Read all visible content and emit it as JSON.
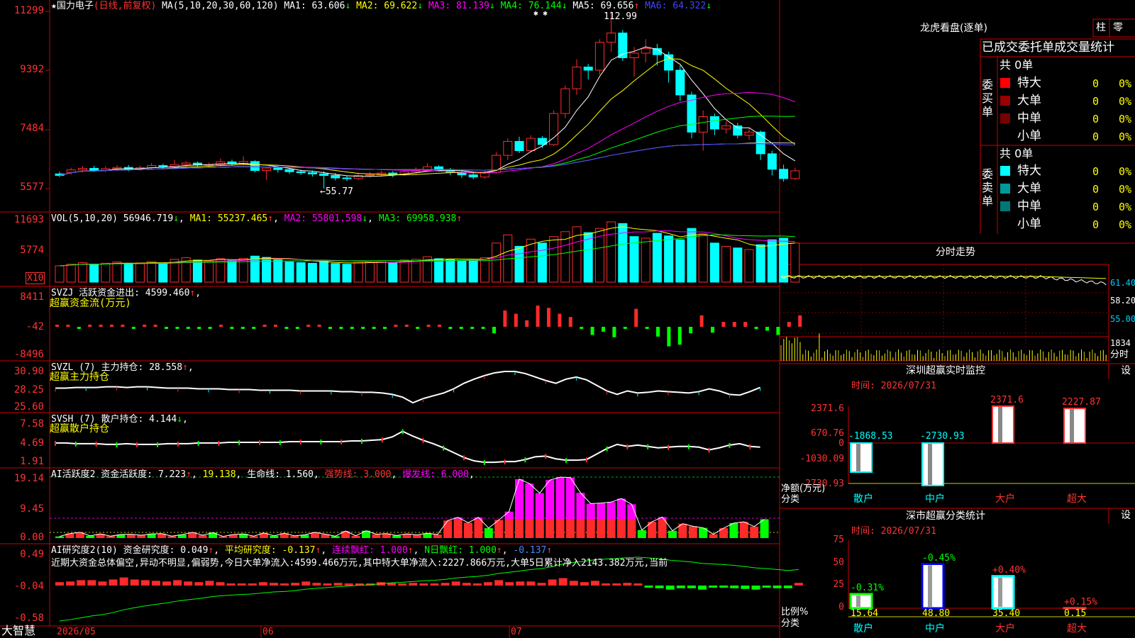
{
  "stock": {
    "name": "国力电子",
    "mode": "(日线,前复权)"
  },
  "colors": {
    "up": "#ff2a2a",
    "down": "#00ffff",
    "grid": "#cc0000",
    "yellow": "#ffff00",
    "magenta": "#ff00ff",
    "green": "#00ff00",
    "white": "#ffffff"
  },
  "panels": {
    "price": {
      "legend": "MA(5,10,20,30,60,120)",
      "ma": [
        {
          "label": "MA1: 63.606",
          "arrow": "↓",
          "color": "#ffffff"
        },
        {
          "label": "MA2: 69.622",
          "arrow": "↓",
          "color": "#ffff00"
        },
        {
          "label": "MA3: 81.139",
          "arrow": "↓",
          "color": "#ff00ff"
        },
        {
          "label": "MA4: 76.144",
          "arrow": "↓",
          "color": "#00ff00"
        },
        {
          "label": "MA5: 69.656",
          "arrow": "↑",
          "color": "#ffffff"
        },
        {
          "label": "MA6: 64.322",
          "arrow": "↓",
          "color": "#4444ff"
        }
      ],
      "y_labels": [
        "11299",
        "9392",
        "7484",
        "5577"
      ],
      "high_mark": "112.99",
      "low_mark": "←55.77",
      "asterisks": "✱ ✱"
    },
    "vol": {
      "legend": "VOL(5,10,20)",
      "value": "56946.719",
      "value_arrow": "↓",
      "ma1": "MA1: 55237.465",
      "ma1_arrow": "↑",
      "ma2": "MA2: 55801.598",
      "ma2_arrow": "↓",
      "ma3": "MA3: 69958.938",
      "ma3_arrow": "↑",
      "y_labels": [
        "11693",
        "5774"
      ],
      "unit": "X10"
    },
    "svzj": {
      "line1": "SVZJ  活跃资金进出: 4599.460",
      "line1_arrow": "↑",
      "line2": "超赢资金流(万元)",
      "y_labels": [
        "8411",
        "-42",
        "-8496"
      ]
    },
    "svzl": {
      "line1": "SVZL (7) 主力持仓: 28.558",
      "line1_arrow": "↑",
      "line2": "超赢主力持仓",
      "y_labels": [
        "30.90",
        "28.25",
        "25.60"
      ]
    },
    "svsh": {
      "line1": "SVSH (7) 散户持仓: 4.144",
      "line1_arrow": "↓",
      "line2": "超赢散户持仓",
      "y_labels": [
        "7.58",
        "4.69",
        "1.91"
      ]
    },
    "ai_active": {
      "title": "AI活跃度2 资金活跃度: 7.223",
      "v2": "19.138",
      "v3": "生命线: 1.560",
      "v4": "强势线: 3.000",
      "v5": "爆发线: 6.000",
      "y_labels": [
        "19.14",
        "9.45",
        "0.00"
      ]
    },
    "ai_research": {
      "title": "AI研究度2(10) 资金研究度: 0.049",
      "v2": "平均研究度: -0.137",
      "v3": "连续飘红: 1.000",
      "v4": "N日飘红: 1.000",
      "v5": "-0.137",
      "note": "近期大资金总体偏空,异动不明显,偏弱势,今日大单净流入:4599.466万元,其中特大单净流入:2227.866万元,大单5日累计净入2143.382万元,当前",
      "y_labels": [
        "0.49",
        "-0.04",
        "-0.58"
      ]
    }
  },
  "xaxis": {
    "brand": "大智慧",
    "dates": [
      "2026/05",
      "06",
      "07"
    ]
  },
  "right": {
    "lhb": {
      "title": "龙虎看盘(逐单)",
      "btn1": "柱",
      "btn2": "零"
    },
    "stats": {
      "header": "已成交委托单成交量统计",
      "buy_label": "委买单",
      "sell_label": "委卖单",
      "buy_total": "共 0单",
      "sell_total": "共 0单",
      "buy_rows": [
        {
          "name": "特大",
          "count": "0",
          "pct": "0%",
          "color": "#ff0000"
        },
        {
          "name": "大单",
          "count": "0",
          "pct": "0%",
          "color": "#990000"
        },
        {
          "name": "中单",
          "count": "0",
          "pct": "0%",
          "color": "#770000"
        },
        {
          "name": "小单",
          "count": "0",
          "pct": "0%",
          "color": ""
        }
      ],
      "sell_rows": [
        {
          "name": "特大",
          "count": "0",
          "pct": "0%",
          "color": "#00ffff"
        },
        {
          "name": "大单",
          "count": "0",
          "pct": "0%",
          "color": "#009999"
        },
        {
          "name": "中单",
          "count": "0",
          "pct": "0%",
          "color": "#007777"
        },
        {
          "name": "小单",
          "count": "0",
          "pct": "0%",
          "color": ""
        }
      ]
    },
    "intraday": {
      "title": "分时走势",
      "y_labels": [
        "61.40",
        "58.20",
        "55.00",
        "1834"
      ],
      "bottom_label": "分时"
    },
    "monitor": {
      "title": "深圳超赢实时监控",
      "btn": "设",
      "time": "时间: 2026/07/31",
      "y_labels": [
        "2371.6",
        "670.76",
        "0",
        "-1030.09",
        "-2730.93"
      ],
      "axis_title": "净额(万元)",
      "axis_sub": "分类",
      "categories": [
        "散户",
        "中户",
        "大户",
        "超大"
      ],
      "values": [
        -1868.53,
        -2730.93,
        2371.6,
        2227.87
      ],
      "value_labels": [
        "-1868.53",
        "-2730.93",
        "2371.6",
        "2227.87"
      ]
    },
    "classify": {
      "title": "深市超赢分类统计",
      "btn": "设",
      "time": "时间: 2026/07/31",
      "y_labels": [
        "75",
        "50",
        "25",
        "0"
      ],
      "axis_title": "比例%",
      "axis_sub": "分类",
      "categories": [
        "散户",
        "中户",
        "大户",
        "超大"
      ],
      "values": [
        15.64,
        48.8,
        35.4,
        0.15
      ],
      "value_labels": [
        "15.64",
        "48.80",
        "35.40",
        "0.15"
      ],
      "changes": [
        "-0.31%",
        "-0.45%",
        "+0.40%",
        "+0.15%"
      ]
    }
  },
  "chart_data": {
    "type": "bar",
    "title": "深圳超赢实时监控",
    "categories": [
      "散户",
      "中户",
      "大户",
      "超大"
    ],
    "series": [
      {
        "name": "净额(万元)",
        "values": [
          -1868.53,
          -2730.93,
          2371.6,
          2227.87
        ]
      },
      {
        "name": "比例%",
        "values": [
          15.64,
          48.8,
          35.4,
          0.15
        ]
      }
    ],
    "candles": [
      [
        60.5,
        60.0,
        61.2,
        59.5
      ],
      [
        61.0,
        61.8,
        62.5,
        60.3
      ],
      [
        61.8,
        62.3,
        63.0,
        61.0
      ],
      [
        62.3,
        61.7,
        63.1,
        61.2
      ],
      [
        61.7,
        62.2,
        63.0,
        61.0
      ],
      [
        62.2,
        62.6,
        63.3,
        61.5
      ],
      [
        62.6,
        62.0,
        63.4,
        61.4
      ],
      [
        62.0,
        62.5,
        63.2,
        61.6
      ],
      [
        62.5,
        63.2,
        64.0,
        62.0
      ],
      [
        63.2,
        62.9,
        63.8,
        62.2
      ],
      [
        62.9,
        63.5,
        65.0,
        62.5
      ],
      [
        63.5,
        64.0,
        64.6,
        62.8
      ],
      [
        64.0,
        63.4,
        64.5,
        62.7
      ],
      [
        63.4,
        63.5,
        64.2,
        62.6
      ],
      [
        63.5,
        64.4,
        65.5,
        63.0
      ],
      [
        64.4,
        63.8,
        65.1,
        63.1
      ],
      [
        63.8,
        64.5,
        66.2,
        63.3
      ],
      [
        64.5,
        61.6,
        64.9,
        61.0
      ],
      [
        61.6,
        62.4,
        62.8,
        58.5
      ],
      [
        62.4,
        61.9,
        63.0,
        60.9
      ],
      [
        61.9,
        61.2,
        62.4,
        60.5
      ],
      [
        61.2,
        60.9,
        61.9,
        60.2
      ],
      [
        60.9,
        60.5,
        61.6,
        59.6
      ],
      [
        60.5,
        60.0,
        61.4,
        55.77
      ],
      [
        60.0,
        59.2,
        60.8,
        58.4
      ],
      [
        59.2,
        59.0,
        60.0,
        58.2
      ],
      [
        59.0,
        60.0,
        60.9,
        58.5
      ],
      [
        60.0,
        60.2,
        61.1,
        59.4
      ],
      [
        60.2,
        60.8,
        61.5,
        59.6
      ],
      [
        60.8,
        60.3,
        61.4,
        59.4
      ],
      [
        60.3,
        61.2,
        62.0,
        59.8
      ],
      [
        61.2,
        61.7,
        62.6,
        60.6
      ],
      [
        61.7,
        62.8,
        64.0,
        61.1
      ],
      [
        62.8,
        61.9,
        63.3,
        61.2
      ],
      [
        61.9,
        61.0,
        62.4,
        60.1
      ],
      [
        61.0,
        60.2,
        61.5,
        59.2
      ],
      [
        60.2,
        59.5,
        60.9,
        58.8
      ],
      [
        59.5,
        61.0,
        61.7,
        58.9
      ],
      [
        61.0,
        66.5,
        67.5,
        60.6
      ],
      [
        66.5,
        71.0,
        72.0,
        65.0
      ],
      [
        71.0,
        68.0,
        72.5,
        67.2
      ],
      [
        68.0,
        72.0,
        73.0,
        67.5
      ],
      [
        72.0,
        70.0,
        72.7,
        68.8
      ],
      [
        70.0,
        80.0,
        81.0,
        69.5
      ],
      [
        80.0,
        88.0,
        89.0,
        78.5
      ],
      [
        88.0,
        95.0,
        97.5,
        86.0
      ],
      [
        95.0,
        94.0,
        96.0,
        91.0
      ],
      [
        94.0,
        103.0,
        104.0,
        92.5
      ],
      [
        103.0,
        106.0,
        112.99,
        100.0
      ],
      [
        106.0,
        98.0,
        107.0,
        97.0
      ],
      [
        98.0,
        99.5,
        101.5,
        92.0
      ],
      [
        99.5,
        101.0,
        104.0,
        96.5
      ],
      [
        101.0,
        99.0,
        102.5,
        95.5
      ],
      [
        99.0,
        94.0,
        100.0,
        90.0
      ],
      [
        94.0,
        86.0,
        95.5,
        84.0
      ],
      [
        86.0,
        74.0,
        87.0,
        72.0
      ],
      [
        74.0,
        79.0,
        81.0,
        68.0
      ],
      [
        79.0,
        75.0,
        80.0,
        73.0
      ],
      [
        75.0,
        76.0,
        77.5,
        73.5
      ],
      [
        76.0,
        73.0,
        77.0,
        72.0
      ],
      [
        73.0,
        74.0,
        75.5,
        71.5
      ],
      [
        74.0,
        67.0,
        74.5,
        65.0
      ],
      [
        67.0,
        62.0,
        68.0,
        60.0
      ],
      [
        62.0,
        59.0,
        63.5,
        58.0
      ],
      [
        59.0,
        61.5,
        62.5,
        58.5
      ]
    ],
    "volume": [
      [
        5.0,
        1
      ],
      [
        5.5,
        1
      ],
      [
        6.0,
        1
      ],
      [
        5.5,
        0
      ],
      [
        5.8,
        1
      ],
      [
        6.2,
        1
      ],
      [
        5.6,
        0
      ],
      [
        5.9,
        1
      ],
      [
        6.3,
        1
      ],
      [
        5.7,
        0
      ],
      [
        7.0,
        1
      ],
      [
        7.5,
        1
      ],
      [
        6.8,
        0
      ],
      [
        6.5,
        1
      ],
      [
        7.2,
        1
      ],
      [
        6.6,
        0
      ],
      [
        7.3,
        1
      ],
      [
        8.0,
        0
      ],
      [
        7.6,
        0
      ],
      [
        6.9,
        0
      ],
      [
        6.2,
        0
      ],
      [
        6.0,
        0
      ],
      [
        5.8,
        0
      ],
      [
        6.5,
        0
      ],
      [
        5.7,
        0
      ],
      [
        5.5,
        0
      ],
      [
        6.0,
        1
      ],
      [
        6.2,
        1
      ],
      [
        6.5,
        1
      ],
      [
        6.1,
        0
      ],
      [
        6.8,
        1
      ],
      [
        7.0,
        1
      ],
      [
        7.8,
        1
      ],
      [
        7.2,
        0
      ],
      [
        6.9,
        0
      ],
      [
        6.5,
        0
      ],
      [
        6.8,
        0
      ],
      [
        7.5,
        1
      ],
      [
        12.0,
        1
      ],
      [
        14.5,
        1
      ],
      [
        11.0,
        0
      ],
      [
        13.2,
        1
      ],
      [
        12.0,
        0
      ],
      [
        14.0,
        1
      ],
      [
        15.5,
        1
      ],
      [
        17.0,
        1
      ],
      [
        15.2,
        0
      ],
      [
        16.5,
        1
      ],
      [
        18.5,
        1
      ],
      [
        18.0,
        0
      ],
      [
        14.0,
        0
      ],
      [
        13.5,
        1
      ],
      [
        15.0,
        0
      ],
      [
        14.2,
        0
      ],
      [
        13.0,
        0
      ],
      [
        16.5,
        0
      ],
      [
        14.8,
        1
      ],
      [
        12.0,
        0
      ],
      [
        11.0,
        1
      ],
      [
        10.5,
        0
      ],
      [
        10.0,
        1
      ],
      [
        11.5,
        0
      ],
      [
        13.0,
        0
      ],
      [
        13.5,
        0
      ],
      [
        12.0,
        1
      ]
    ],
    "svzj": [
      0.2,
      0.3,
      -0.1,
      0.2,
      0.3,
      0.2,
      0.2,
      -0.2,
      0.3,
      0.2,
      -0.2,
      -0.3,
      -0.2,
      -0.7,
      -0.1,
      0.3,
      -0.2,
      -0.3,
      -0.2,
      0.2,
      0.2,
      -0.3,
      -0.2,
      0.1,
      0.1,
      -0.2,
      -0.2,
      -0.6,
      -0.3,
      -0.2,
      -0.2,
      0.1,
      0.2,
      -0.2,
      0.2,
      0.1,
      -0.1,
      -0.1,
      -0.2,
      -0.2,
      -2.0,
      5.0,
      4.0,
      2.0,
      6.5,
      5.8,
      4.0,
      3.0,
      -0.3,
      -2.5,
      -1.5,
      -3.2,
      -0.6,
      5.5,
      -0.2,
      -3.0,
      -6.0,
      -5.5,
      -2.0,
      3.5,
      -1.8,
      1.5,
      1.5,
      1.5,
      -0.7,
      -1.2,
      -2.5,
      1.5,
      3.5
    ],
    "svzl": [
      28.5,
      28.5,
      28.6,
      28.6,
      28.6,
      28.7,
      28.7,
      28.6,
      28.7,
      28.7,
      28.6,
      28.5,
      28.5,
      28.5,
      28.4,
      28.4,
      28.4,
      28.3,
      28.3,
      28.3,
      28.2,
      28.2,
      28.2,
      28.2,
      28.1,
      28.1,
      28.1,
      28.1,
      28.0,
      28.0,
      27.9,
      27.9,
      27.8,
      27.6,
      27.2,
      26.4,
      27.0,
      27.4,
      27.8,
      28.4,
      29.2,
      29.8,
      30.3,
      30.7,
      30.9,
      30.9,
      30.6,
      30.1,
      29.6,
      29.2,
      29.8,
      30.1,
      29.7,
      28.9,
      28.1,
      27.6,
      28.1,
      27.8,
      27.9,
      28.1,
      28.0,
      27.9,
      27.8,
      28.0,
      28.4,
      28.1,
      27.6,
      27.5,
      28.0,
      28.6
    ],
    "svsh": [
      4.7,
      4.7,
      4.6,
      4.6,
      4.6,
      4.5,
      4.5,
      4.6,
      4.5,
      4.5,
      4.5,
      4.6,
      4.6,
      4.6,
      4.7,
      4.7,
      4.7,
      4.8,
      4.8,
      4.8,
      4.8,
      4.8,
      4.8,
      4.9,
      4.9,
      4.9,
      4.9,
      4.9,
      4.9,
      5.0,
      5.0,
      5.1,
      5.2,
      5.6,
      6.4,
      5.7,
      5.1,
      4.6,
      4.0,
      3.3,
      2.6,
      2.1,
      1.9,
      1.9,
      2.0,
      2.0,
      2.3,
      2.7,
      2.8,
      2.4,
      2.2,
      2.2,
      2.3,
      3.1,
      3.9,
      4.5,
      4.2,
      4.4,
      4.2,
      4.0,
      4.1,
      4.2,
      4.2,
      4.1,
      3.7,
      4.0,
      4.4,
      4.6,
      4.2,
      4.1
    ],
    "ai_active": [
      0.5,
      1.4,
      1.8,
      0.7,
      1.3,
      0.6,
      1.1,
      1.2,
      0.9,
      1.3,
      1.4,
      0.6,
      1.1,
      1.8,
      0.9,
      1.7,
      0.5,
      1.1,
      1.3,
      0.6,
      1.6,
      0.7,
      1.5,
      0.7,
      1.0,
      1.8,
      1.2,
      0.6,
      2.2,
      0.7,
      2.3,
      1.2,
      1.4,
      0.8,
      1.3,
      1.0,
      1.5,
      1.1,
      5.5,
      6.5,
      4.8,
      6.5,
      3.1,
      5.7,
      8.3,
      18.5,
      17.1,
      14.1,
      18.2,
      19.1,
      19.0,
      14.2,
      10.8,
      11.0,
      11.3,
      12.4,
      10.6,
      2.5,
      5.1,
      6.6,
      2.3,
      4.5,
      3.7,
      3.2,
      1.2,
      3.1,
      4.7,
      5.1,
      3.6,
      5.9
    ],
    "ai_research": [
      0.05,
      0.06,
      0.08,
      0.08,
      0.06,
      0.09,
      0.12,
      0.09,
      0.08,
      0.07,
      0.06,
      0.08,
      0.06,
      0.05,
      0.07,
      0.05,
      0.03,
      0.03,
      0.02,
      0.05,
      0.04,
      0.02,
      0.04,
      0.06,
      0.04,
      0.03,
      0.04,
      0.03,
      0.03,
      0.02,
      0.05,
      0.04,
      0.02,
      0.04,
      0.03,
      0.02,
      0.04,
      0.06,
      0.04,
      0.03,
      0.05,
      0.08,
      0.05,
      0.06,
      0.06,
      0.04,
      0.09,
      0.11,
      0.07,
      0.05,
      0.07,
      0.03,
      0.02,
      0.04,
      0.02,
      -0.03,
      -0.04,
      -0.06,
      -0.04,
      -0.04,
      -0.06,
      -0.03,
      -0.02,
      -0.04,
      -0.05,
      -0.06,
      -0.03,
      -0.04,
      -0.04,
      0.04
    ]
  }
}
